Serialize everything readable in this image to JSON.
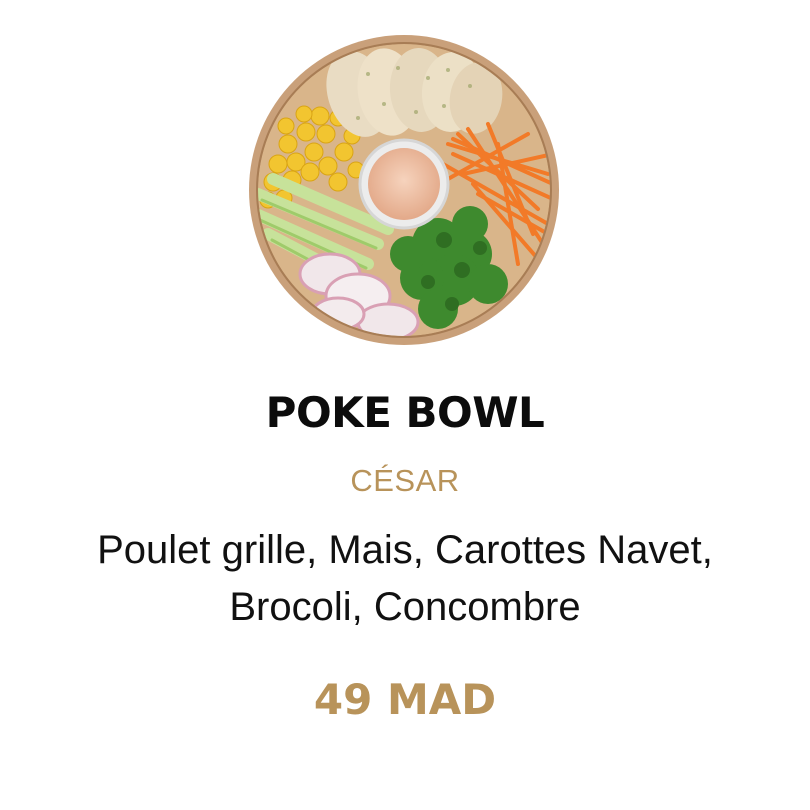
{
  "product": {
    "image_alt": "poke-bowl-photo",
    "title": "POKE BOWL",
    "variant": "CÉSAR",
    "description_line1": "Poulet grille, Mais, Carottes Navet,",
    "description_line2": "Brocoli, Concombre",
    "price": "49 MAD"
  },
  "colors": {
    "accent": "#b8935a",
    "title": "#0c0c0c",
    "text": "#111111",
    "background": "#ffffff"
  }
}
